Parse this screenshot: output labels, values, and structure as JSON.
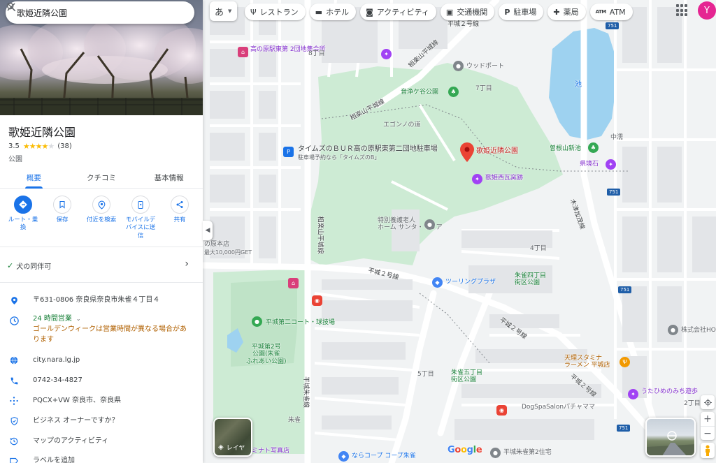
{
  "search": {
    "value": "歌姫近隣公園"
  },
  "panel": {
    "title": "歌姫近隣公園",
    "rating": "3.5",
    "review_count": "(38)",
    "category": "公園",
    "tabs": [
      "概要",
      "クチコミ",
      "基本情報"
    ],
    "actions": [
      {
        "label": "ルート・乗\n換",
        "icon": "directions-icon"
      },
      {
        "label": "保存",
        "icon": "bookmark-icon"
      },
      {
        "label": "付近を検索",
        "icon": "nearby-icon"
      },
      {
        "label": "モバイルデ\nバイスに送\n信",
        "icon": "send-to-phone-icon"
      },
      {
        "label": "共有",
        "icon": "share-icon"
      }
    ],
    "dog_friendly": "犬の同伴可",
    "address": "〒631-0806 奈良県奈良市朱雀４丁目４",
    "hours_status": "24 時間営業",
    "hours_note": "ゴールデンウィークは営業時間が異なる場合があります",
    "website": "city.nara.lg.jp",
    "phone": "0742-34-4827",
    "plus_code": "PQCX+VW 奈良市、奈良県",
    "owner_prompt": "ビジネス オーナーですか？",
    "activity": "マップのアクティビティ",
    "add_label": "ラベルを追加"
  },
  "top": {
    "ime": "あ",
    "chips": [
      {
        "label": "レストラン",
        "icon": "restaurant-icon"
      },
      {
        "label": "ホテル",
        "icon": "hotel-icon"
      },
      {
        "label": "アクティビティ",
        "icon": "camera-icon"
      },
      {
        "label": "交通機関",
        "icon": "transit-icon"
      },
      {
        "label": "駐車場",
        "icon": "parking-icon"
      },
      {
        "label": "薬局",
        "icon": "pharmacy-icon"
      },
      {
        "label": "ATM",
        "icon": "atm-icon"
      }
    ],
    "avatar": "Y"
  },
  "map": {
    "layers_label": "レイヤ",
    "google": [
      "G",
      "o",
      "o",
      "g",
      "l",
      "e"
    ],
    "places": {
      "selected": "歌姫近隣公園",
      "takanohara2": "高の原駅東第\n2団地集会所",
      "woodport": "ウッドポート",
      "otojogaike": "音浄ケ谷公園",
      "times": "タイムズのＢＵＲ高の原駅東第二団地駐車場",
      "times_sub": "駐車場予約なら「タイムズのB」",
      "sonekoyama": "曽根山新池",
      "kenkyoseki": "県境石",
      "utahime_kawara": "歌姫西瓦窯跡",
      "tokubetsu": "特別養護老人\nホーム サンタ・マリア",
      "touring": "ツーリングプラザ",
      "sujaku4": "朱雀四丁目\n街区公園",
      "court": "平城第二コート・球技場",
      "heijo2park": "平城第2号\n公園(朱雀\nふれあい公園)",
      "sujaku5": "朱雀五丁目\n街区公園",
      "tenri": "天理スタミナ\nラーメン 平城店",
      "utahime_road": "うたひめのみち遊歩",
      "kabushiki": "株式会社HO",
      "dogspa": "DogSpaSalonパチャママ",
      "naracoop": "ならコープ コープ朱雀",
      "heijo_jutaku": "平城朱雀第2住宅",
      "photo": "ミナト写真店",
      "honten": "の原本店",
      "honten_sub": "最大10,000円GET",
      "ike": "池"
    },
    "roads": {
      "heijo2": "平城２号線",
      "sagara": "相楽山平城線",
      "sujaku": "平城朱雀線",
      "egashira": "エゴンノの道",
      "cho8": "8丁目",
      "cho7": "7丁目",
      "cho4": "4丁目",
      "cho5": "5丁目",
      "cho4b": "4丁目",
      "cho2": "2丁目",
      "naka": "中濡",
      "suzaku_label": "朱雀",
      "kamohiko": "木津加茂線",
      "chukai": "中瀬"
    },
    "shields": [
      "751",
      "751",
      "751",
      "751"
    ]
  }
}
